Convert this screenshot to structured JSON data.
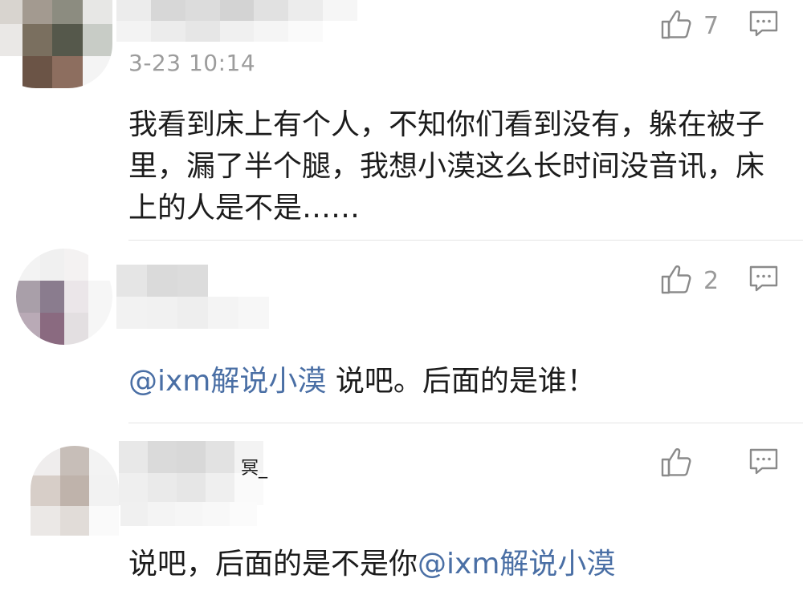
{
  "comments": [
    {
      "timestamp": "3-23 10:14",
      "likes": "7",
      "text": "我看到床上有个人，不知你们看到没有，躲在被子里，漏了半个腿，我想小漠这么长时间没音讯，床上的人是不是……"
    },
    {
      "likes": "2",
      "mention": "@ixm解说小漠",
      "text": " 说吧。后面的是谁！"
    },
    {
      "name_visible_fragment": "冥_",
      "likes": "",
      "text": "说吧，后面的是不是你",
      "mention": "@ixm解说小漠"
    }
  ],
  "icons": {
    "like": "thumbs-up-icon",
    "reply": "comment-bubble-icon"
  },
  "colors": {
    "text": "#1c1c1c",
    "meta": "#9c9c9c",
    "mention": "#4a6fa5",
    "divider": "#e4e4e4",
    "icon": "#8a8a8a"
  }
}
